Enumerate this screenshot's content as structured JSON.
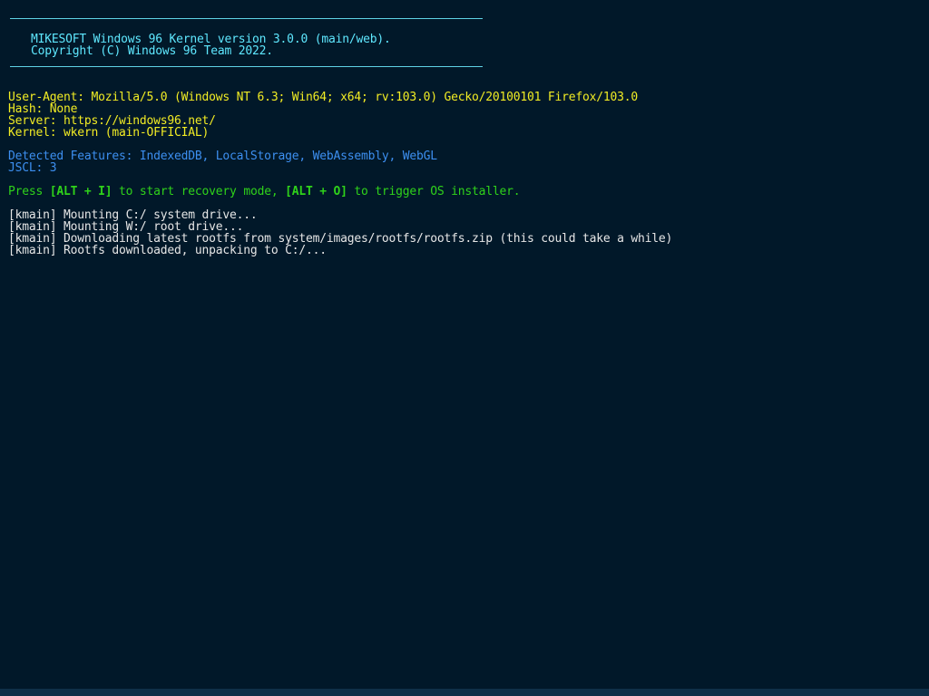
{
  "banner": {
    "line1": "MIKESOFT Windows 96 Kernel version 3.0.0 (main/web).",
    "line2": "Copyright (C) Windows 96 Team 2022."
  },
  "system_info": {
    "user_agent": "User-Agent: Mozilla/5.0 (Windows NT 6.3; Win64; x64; rv:103.0) Gecko/20100101 Firefox/103.0",
    "hash": "Hash: None",
    "server": "Server: https://windows96.net/",
    "kernel": "Kernel: wkern (main-OFFICIAL)"
  },
  "features": {
    "detected": "Detected Features: IndexedDB, LocalStorage, WebAssembly, WebGL",
    "jscl": "JSCL: 3"
  },
  "prompt": {
    "press": "Press ",
    "recovery_key": "[ALT + I]",
    "middle": " to start recovery mode, ",
    "installer_key": "[ALT + O]",
    "end": " to trigger OS installer."
  },
  "log": [
    "[kmain] Mounting C:/ system drive...",
    "[kmain] Mounting W:/ root drive...",
    "[kmain] Downloading latest rootfs from system/images/rootfs/rootfs.zip (this could take a while)",
    "[kmain] Rootfs downloaded, unpacking to C:/..."
  ]
}
